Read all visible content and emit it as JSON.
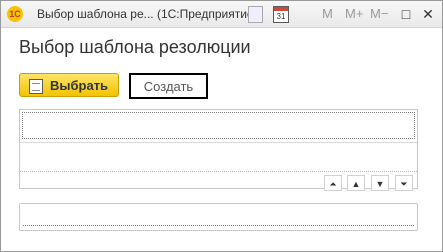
{
  "window": {
    "title": "Выбор шаблона ре...  (1С:Предприятие)",
    "logo_text": "1С",
    "calendar_day": "31",
    "m_labels": [
      "M",
      "M+",
      "M−"
    ],
    "controls": {
      "restore": "□",
      "close": "✕"
    }
  },
  "form": {
    "heading": "Выбор шаблона резолюции",
    "select_button": "Выбрать",
    "create_button": "Создать"
  },
  "table": {
    "nav_buttons": [
      "⏶",
      "▲",
      "▼",
      "⏷"
    ],
    "rows": [
      ""
    ]
  },
  "text_field": {
    "value": ""
  },
  "icons": {
    "app": "1c-logo-icon",
    "sheet": "document-icon",
    "calendar": "calendar-icon",
    "select": "document-select-icon"
  }
}
